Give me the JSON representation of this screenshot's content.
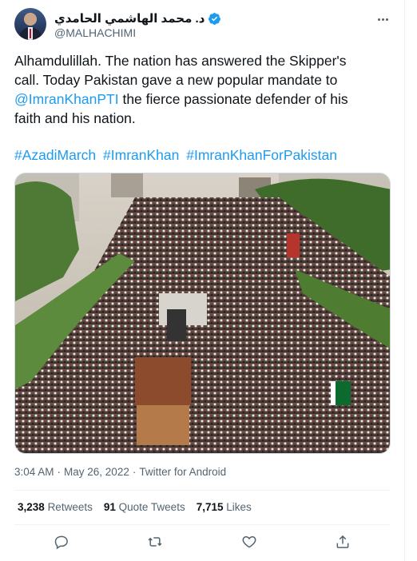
{
  "author": {
    "display_name": "د. محمد الهاشمي الحامدي",
    "handle": "@MALHACHIMI",
    "verified": true
  },
  "tweet": {
    "text_line1": "Alhamdulillah. The nation has answered the Skipper's",
    "text_line2": "call. Today Pakistan gave a new popular mandate to",
    "mention": "@ImranKhanPTI",
    "text_line3_rest": " the fierce passionate defender of his",
    "text_line4": "faith and his nation.",
    "hashtags": [
      "#AzadiMarch",
      "#ImranKhan",
      "#ImranKhanForPakistan"
    ]
  },
  "meta": {
    "time": "3:04 AM",
    "separator": "·",
    "date": "May 26, 2022",
    "source": "Twitter for Android"
  },
  "stats": {
    "retweets_count": "3,238",
    "retweets_label": "Retweets",
    "quotes_count": "91",
    "quotes_label": "Quote Tweets",
    "likes_count": "7,715",
    "likes_label": "Likes"
  },
  "colors": {
    "accent": "#1d9bf0",
    "text": "#0f1419",
    "secondary": "#536471",
    "border": "#eff3f4"
  },
  "icons": {
    "reply": "reply-icon",
    "retweet": "retweet-icon",
    "like": "like-icon",
    "share": "share-icon",
    "more": "more-icon",
    "verified": "verified-icon"
  }
}
